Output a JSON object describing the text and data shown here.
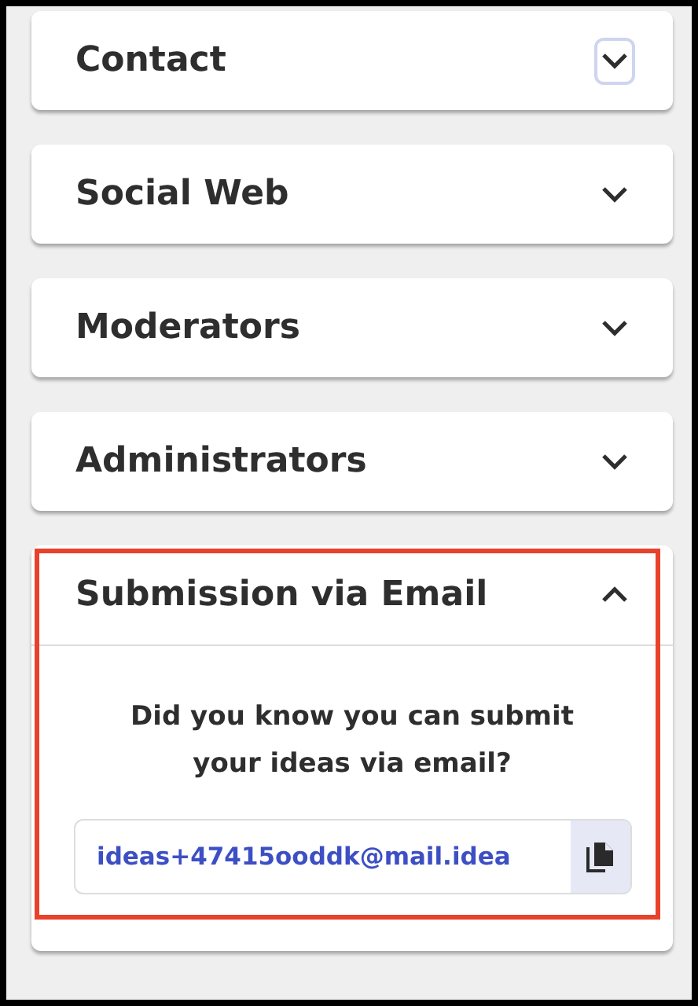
{
  "sections": [
    {
      "title": "Contact",
      "expanded": false,
      "focused": true,
      "highlighted": false
    },
    {
      "title": "Social Web",
      "expanded": false,
      "focused": false,
      "highlighted": false
    },
    {
      "title": "Moderators",
      "expanded": false,
      "focused": false,
      "highlighted": false
    },
    {
      "title": "Administrators",
      "expanded": false,
      "focused": false,
      "highlighted": false
    },
    {
      "title": "Submission via Email",
      "expanded": true,
      "focused": false,
      "highlighted": true,
      "question": "Did you know you can submit your ideas via email?",
      "email": "ideas+47415ooddk@mail.idea"
    }
  ]
}
